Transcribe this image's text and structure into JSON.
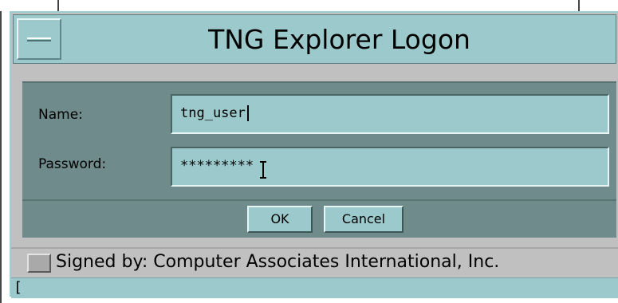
{
  "window": {
    "title": "TNG Explorer Logon"
  },
  "form": {
    "name_label": "Name:",
    "name_value": "tng_user",
    "password_label": "Password:",
    "password_value": "*********"
  },
  "buttons": {
    "ok_label": "OK",
    "cancel_label": "Cancel"
  },
  "status": {
    "signed_by": "Signed by: Computer Associates International, Inc.",
    "bottom_text": "["
  },
  "icons": {
    "window_menu": "window-menu-icon",
    "text_cursor": "ibeam-cursor-icon"
  },
  "colors": {
    "title_bg": "#9cc9cb",
    "form_bg": "#6f8b8b",
    "field_bg": "#9cc9cb",
    "window_bg": "#c0c0c0"
  }
}
